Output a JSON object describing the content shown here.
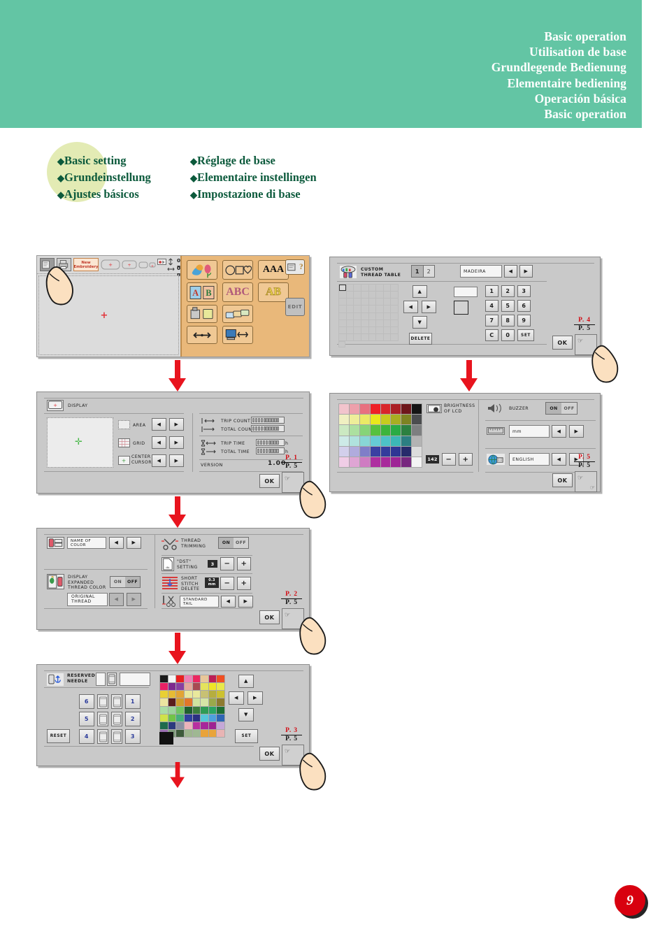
{
  "header": {
    "titles": [
      "Basic operation",
      "Utilisation de base",
      "Grundlegende Bedienung",
      "Elementaire bediening",
      "Operación básica",
      "Basic operation"
    ],
    "band_color": "#63c5a4"
  },
  "subtitle": {
    "bullet": "◆",
    "col1": [
      "Basic setting",
      "Grundeinstellung",
      "Ajustes básicos"
    ],
    "col2": [
      "Réglage de base",
      "Elementaire instellingen",
      "Impostazione di base"
    ],
    "blob_color": "#e3ebb4",
    "text_color": "#0c5a3c"
  },
  "page_badge": {
    "number": "9",
    "color": "#d8000f"
  },
  "screens": {
    "home": {
      "name": "home-screen",
      "new_embroidery_label": "New\nEmbroidery",
      "dim_x": "0 mm",
      "dim_y": "0 mm",
      "edit_label": "EDIT",
      "categories": [
        {
          "name": "embroidery-patterns",
          "icon": "bird-flower-icon"
        },
        {
          "name": "frame-patterns",
          "icon": "shapes-icon"
        },
        {
          "name": "alphabet-patterns",
          "icon": "AAA"
        },
        {
          "name": "monogram-patterns",
          "icon": "framed-AB"
        },
        {
          "name": "decorative-alphabet",
          "icon": "ABC"
        },
        {
          "name": "outline-alphabet",
          "icon": "AB"
        },
        {
          "name": "machine-memory",
          "icon": "machine-pocket-icon"
        },
        {
          "name": "card-memory",
          "icon": "cards-icon"
        },
        {
          "name": "usb-media",
          "icon": "usb-icon"
        },
        {
          "name": "computer-usb",
          "icon": "computer-usb-icon"
        }
      ]
    },
    "custom_thread_table": {
      "title": "CUSTOM\nTHREAD TABLE",
      "tabs": [
        "1",
        "2"
      ],
      "selected_tab": "1",
      "brand_value": "MADEIRA",
      "keypad": [
        "1",
        "2",
        "3",
        "4",
        "5",
        "6",
        "7",
        "8",
        "9",
        "C",
        "0",
        "SET"
      ],
      "delete_label": "DELETE",
      "ok_label": "OK",
      "page_top": "P. 4",
      "page_bottom": "P. 5"
    },
    "display": {
      "title": "DISPLAY",
      "rows": [
        {
          "label": "AREA"
        },
        {
          "label": "GRID"
        },
        {
          "label": "CENTER\nCURSOR"
        }
      ],
      "counters": [
        {
          "label": "TRIP COUNT",
          "unit": ""
        },
        {
          "label": "TOTAL COUNT",
          "unit": ""
        },
        {
          "label": "TRIP TIME",
          "unit": "h"
        },
        {
          "label": "TOTAL TIME",
          "unit": "h"
        }
      ],
      "version_label": "VERSION",
      "version_value": "1.00",
      "ok_label": "OK",
      "page_top": "P. 1",
      "page_bottom": "P. 5"
    },
    "brightness": {
      "brightness_label": "BRIGHTNESS\nOF LCD",
      "brightness_value": "142",
      "minus": "−",
      "plus": "+",
      "buzzer_label": "BUZZER",
      "buzzer_on": "ON",
      "buzzer_off": "OFF",
      "buzzer_state": "ON",
      "unit_value": "mm",
      "language_value": "ENGLISH",
      "ok_label": "OK",
      "page_top": "P. 5",
      "page_bottom": "P. 5",
      "palette": [
        [
          "#f2c4cc",
          "#eda0ab",
          "#e8707f",
          "#ef2026",
          "#d9262a",
          "#ab2026",
          "#6e171b",
          "#151515"
        ],
        [
          "#f0f0c2",
          "#eeee9a",
          "#eaea66",
          "#e8e81c",
          "#c8cc1e",
          "#a8ae22",
          "#7d8322",
          "#4b4d4f"
        ],
        [
          "#cbe9c2",
          "#ace0a0",
          "#86d478",
          "#56c13f",
          "#3cb43a",
          "#2aab44",
          "#2c8040",
          "#7d7f80"
        ],
        [
          "#cdeae7",
          "#b0e2de",
          "#88d7d6",
          "#66cbd5",
          "#4dc2c7",
          "#3cb7b6",
          "#2c7f82",
          "#b3b3b3"
        ],
        [
          "#d2cfeb",
          "#b0abdd",
          "#7f7ec8",
          "#3a40a2",
          "#333c9c",
          "#2e3694",
          "#262b6b",
          "#dcdcdc"
        ],
        [
          "#f0cde6",
          "#dfa5d4",
          "#cf7cc2",
          "#ae2fa0",
          "#a82a9b",
          "#9e2596",
          "#77277f",
          "#f4f4f4"
        ]
      ]
    },
    "color_settings": {
      "name_of_color_label": "NAME OF COLOR",
      "display_expanded_label": "DISPLAY\nEXPANDED\nTHREAD COLOR",
      "expanded_on": "ON",
      "expanded_off": "OFF",
      "expanded_state": "OFF",
      "original_thread_label": "ORIGINAL\nTHREAD",
      "thread_trimming_label": "THREAD\nTRIMMING",
      "trim_on": "ON",
      "trim_off": "OFF",
      "trim_state": "ON",
      "dst_setting_label": "\"DST\"\nSETTING",
      "dst_value": "3",
      "short_stitch_label": "SHORT\nSTITCH\nDELETE",
      "short_stitch_value": "0.3\nmm",
      "standard_tail_label": "STANDARD TAIL",
      "minus": "−",
      "plus": "+",
      "ok_label": "OK",
      "page_top": "P. 2",
      "page_bottom": "P. 5"
    },
    "reserved_needle": {
      "title": "RESERVED\nNEEDLE",
      "needle_numbers_left": [
        "6",
        "5",
        "4"
      ],
      "needle_numbers_right": [
        "1",
        "2",
        "3"
      ],
      "reset_label": "RESET",
      "set_label": "SET",
      "ok_label": "OK",
      "page_top": "P. 3",
      "page_bottom": "P. 5",
      "palette": [
        [
          "#1a1a1a",
          "#f5f5f5",
          "#e8201f",
          "#ef7fb4",
          "#ec2761",
          "#e8c79a",
          "#bc1f56",
          "#f04f22"
        ],
        [
          "#e82165",
          "#7e2a8e",
          "#8a3fa0",
          "#e5a79c",
          "#a84a52",
          "#e4e35c",
          "#efe426",
          "#e9e84a"
        ],
        [
          "#e9cf33",
          "#e7bb34",
          "#e2a434",
          "#e8e79b",
          "#e9e89c",
          "#c8c174",
          "#b6ae3e",
          "#cdc12f"
        ],
        [
          "#ece3a0",
          "#5a1d1d",
          "#cf9b2d",
          "#e2762a",
          "#cfe3a0",
          "#d6e5a6",
          "#9aa94b",
          "#8d7a2f"
        ],
        [
          "#a9dca4",
          "#9cd49b",
          "#71c461",
          "#1f5f2e",
          "#3c7c3c",
          "#2f9b54",
          "#2aa463",
          "#1e6e33"
        ],
        [
          "#cfe24a",
          "#71c448",
          "#46b07a",
          "#2f3f9e",
          "#2b3082",
          "#56c6d8",
          "#4da0dd",
          "#2f66b4"
        ],
        [
          "#1f6b4c",
          "#2b3a7e",
          "#8a8fa2",
          "#ecb3bb",
          "#b82fa0",
          "#a7279a",
          "#9e2392",
          "#c5a8d8"
        ],
        [
          "#9a6fb0",
          "#7e9a7b",
          "#3d5a3a",
          "#9eb58e",
          "#9fb892",
          "#e9a33a",
          "#e9a43a",
          "#e8b4b4"
        ],
        [
          "#111111",
          "",
          "",
          "",
          "",
          "",
          "",
          ""
        ]
      ]
    }
  }
}
